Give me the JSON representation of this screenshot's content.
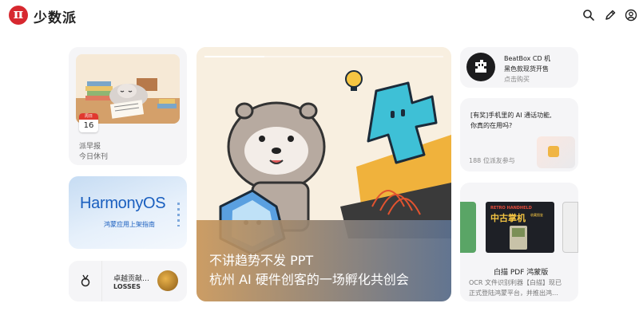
{
  "header": {
    "logo_glyph": "π",
    "brand": "少数派",
    "icons": [
      "search-icon",
      "pen-icon",
      "user-icon"
    ]
  },
  "morning": {
    "calendar_month": "周日",
    "calendar_day": "16",
    "title": "派早报",
    "subtitle": "今日休刊"
  },
  "harmony": {
    "logo": "HarmonyOS",
    "subtitle": "鸿蒙应用上架指南"
  },
  "losses": {
    "title": "卓越贡献…",
    "subtitle": "LOSSES"
  },
  "hero": {
    "progress": 0.25,
    "line1": "不讲趋势不发 PPT",
    "line2": "杭州 AI 硬件创客的一场孵化共创会"
  },
  "beatbox": {
    "title": "BeatBox CD 机",
    "subtitle": "黑色款现货开售",
    "cta": "点击购买"
  },
  "aicall": {
    "title_line1": "[有奖]手机里的 AI 通话功能,",
    "title_line2": "你真的在用吗?",
    "meta": "188 位派友参与"
  },
  "scan": {
    "image_line1": "RETRO HANDHELD",
    "image_line2": "中古掌机",
    "image_line3": "收藏图鉴",
    "title": "白描 PDF 鸿蒙版",
    "desc_line1": "OCR 文件识别利器【白描】现已",
    "desc_line2": "正式登陆鸿蒙平台，并推出鸿…"
  },
  "colors": {
    "brand_red": "#d7282f",
    "harmony_blue": "#1a5fbf"
  }
}
